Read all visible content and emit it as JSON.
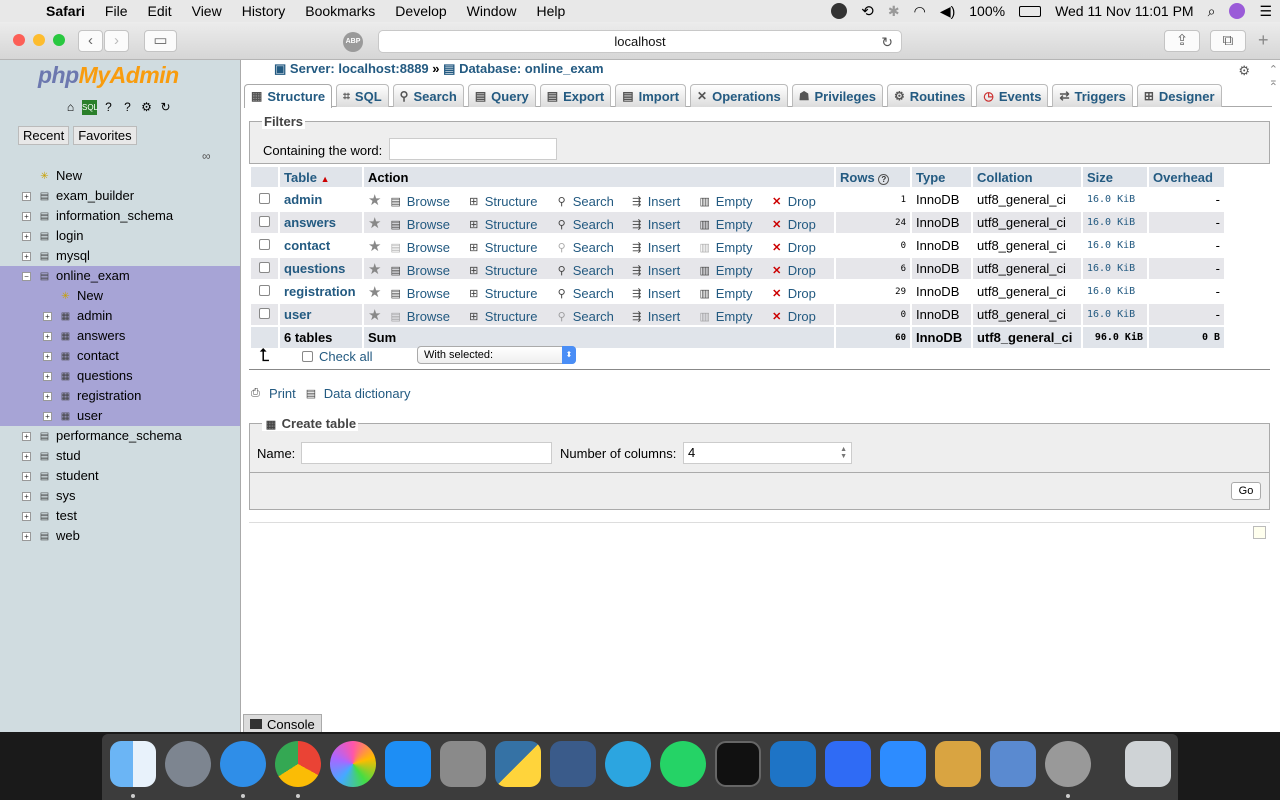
{
  "menubar": {
    "app": "Safari",
    "items": [
      "File",
      "Edit",
      "View",
      "History",
      "Bookmarks",
      "Develop",
      "Window",
      "Help"
    ],
    "battery": "100%",
    "clock": "Wed 11 Nov  11:01 PM"
  },
  "browser": {
    "url": "localhost",
    "abp": "ABP"
  },
  "sidebar": {
    "logo_part1": "php",
    "logo_part2": "MyAdmin",
    "tab_recent": "Recent",
    "tab_favorites": "Favorites",
    "tree": [
      {
        "label": "New",
        "level": 0,
        "expandable": false
      },
      {
        "label": "exam_builder",
        "level": 0,
        "expandable": true
      },
      {
        "label": "information_schema",
        "level": 0,
        "expandable": true
      },
      {
        "label": "login",
        "level": 0,
        "expandable": true
      },
      {
        "label": "mysql",
        "level": 0,
        "expandable": true
      },
      {
        "label": "online_exam",
        "level": 0,
        "expandable": true,
        "open": true
      },
      {
        "label": "New",
        "level": 1,
        "expandable": false
      },
      {
        "label": "admin",
        "level": 1,
        "expandable": true
      },
      {
        "label": "answers",
        "level": 1,
        "expandable": true
      },
      {
        "label": "contact",
        "level": 1,
        "expandable": true
      },
      {
        "label": "questions",
        "level": 1,
        "expandable": true
      },
      {
        "label": "registration",
        "level": 1,
        "expandable": true
      },
      {
        "label": "user",
        "level": 1,
        "expandable": true
      },
      {
        "label": "performance_schema",
        "level": 0,
        "expandable": true
      },
      {
        "label": "stud",
        "level": 0,
        "expandable": true
      },
      {
        "label": "student",
        "level": 0,
        "expandable": true
      },
      {
        "label": "sys",
        "level": 0,
        "expandable": true
      },
      {
        "label": "test",
        "level": 0,
        "expandable": true
      },
      {
        "label": "web",
        "level": 0,
        "expandable": true
      }
    ]
  },
  "breadcrumb": {
    "server": "Server: localhost:8889",
    "separator": "»",
    "database": "Database: online_exam"
  },
  "tabs": [
    "Structure",
    "SQL",
    "Search",
    "Query",
    "Export",
    "Import",
    "Operations",
    "Privileges",
    "Routines",
    "Events",
    "Triggers",
    "Designer"
  ],
  "filters": {
    "legend": "Filters",
    "label": "Containing the word:",
    "value": ""
  },
  "table": {
    "headers": {
      "table": "Table",
      "action": "Action",
      "rows": "Rows",
      "type": "Type",
      "collation": "Collation",
      "size": "Size",
      "overhead": "Overhead"
    },
    "actions": [
      "Browse",
      "Structure",
      "Search",
      "Insert",
      "Empty",
      "Drop"
    ],
    "rows": [
      {
        "name": "admin",
        "rows": "1",
        "type": "InnoDB",
        "collation": "utf8_general_ci",
        "size": "16.0 KiB",
        "overhead": "-",
        "empty": false
      },
      {
        "name": "answers",
        "rows": "24",
        "type": "InnoDB",
        "collation": "utf8_general_ci",
        "size": "16.0 KiB",
        "overhead": "-",
        "empty": false
      },
      {
        "name": "contact",
        "rows": "0",
        "type": "InnoDB",
        "collation": "utf8_general_ci",
        "size": "16.0 KiB",
        "overhead": "-",
        "empty": true
      },
      {
        "name": "questions",
        "rows": "6",
        "type": "InnoDB",
        "collation": "utf8_general_ci",
        "size": "16.0 KiB",
        "overhead": "-",
        "empty": false
      },
      {
        "name": "registration",
        "rows": "29",
        "type": "InnoDB",
        "collation": "utf8_general_ci",
        "size": "16.0 KiB",
        "overhead": "-",
        "empty": false
      },
      {
        "name": "user",
        "rows": "0",
        "type": "InnoDB",
        "collation": "utf8_general_ci",
        "size": "16.0 KiB",
        "overhead": "-",
        "empty": true
      }
    ],
    "footer": {
      "count": "6 tables",
      "sum": "Sum",
      "rows": "60",
      "type": "InnoDB",
      "collation": "utf8_general_ci",
      "size": "96.0 KiB",
      "overhead": "0 B"
    }
  },
  "bulk": {
    "check_all": "Check all",
    "with_selected": "With selected:"
  },
  "links": {
    "print": "Print",
    "data_dictionary": "Data dictionary"
  },
  "create_table": {
    "legend": "Create table",
    "name_label": "Name:",
    "name_value": "",
    "columns_label": "Number of columns:",
    "columns_value": "4",
    "go": "Go"
  },
  "console": {
    "label": "Console"
  }
}
